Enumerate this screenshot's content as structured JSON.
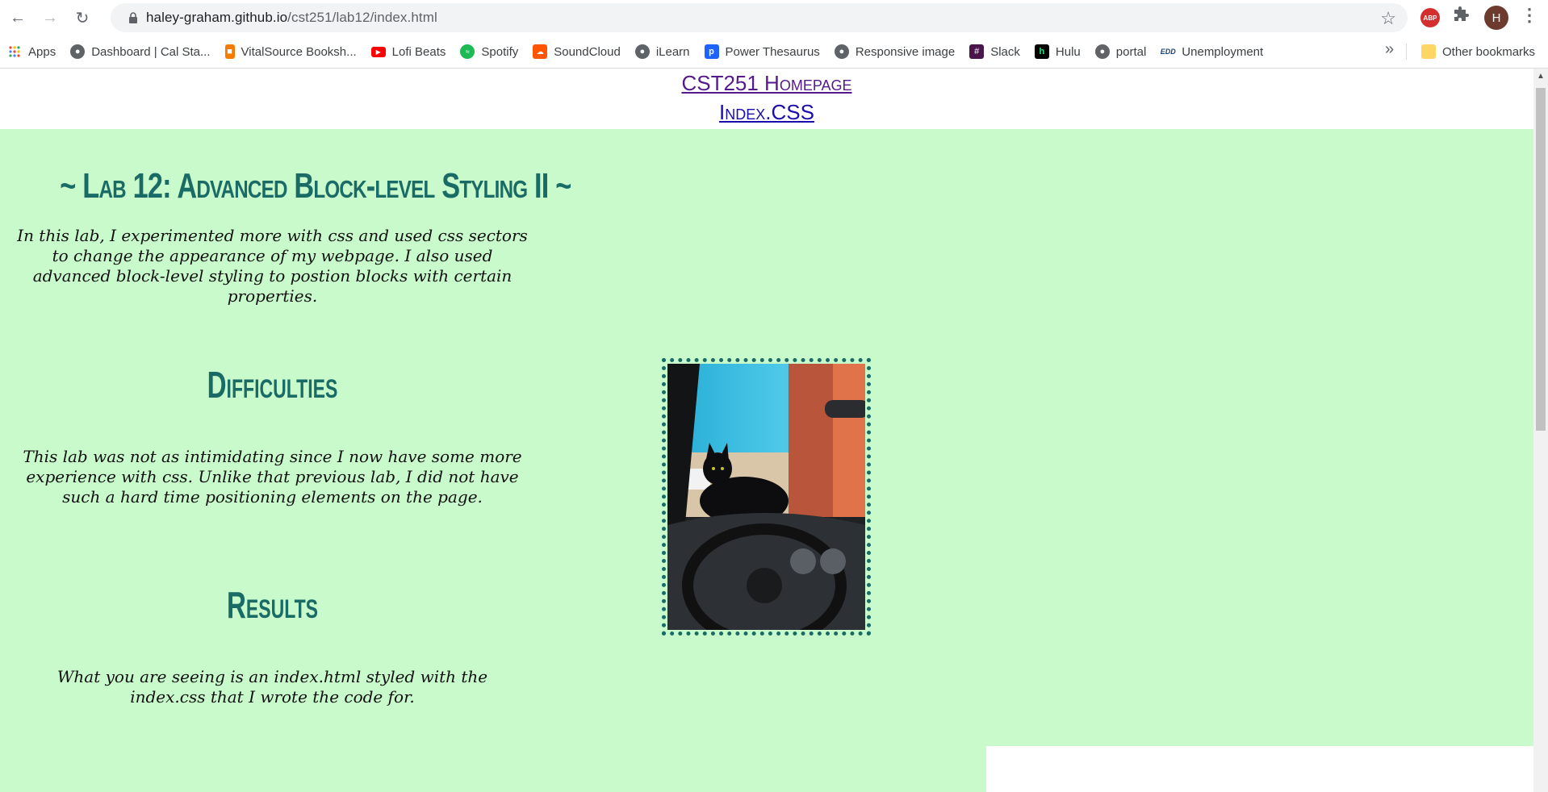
{
  "browser": {
    "url_host": "haley-graham.github.io",
    "url_path": "/cst251/lab12/index.html",
    "profile_initial": "H",
    "abp_label": "ABP"
  },
  "bookmarks": [
    {
      "label": "Apps",
      "icon": "apps-grid-icon",
      "color": "#4285f4"
    },
    {
      "label": "Dashboard | Cal Sta...",
      "icon": "globe-icon",
      "color": "#5f6368"
    },
    {
      "label": "VitalSource Booksh...",
      "icon": "vitalsource-icon",
      "color": "#f57c00"
    },
    {
      "label": "Lofi Beats",
      "icon": "youtube-icon",
      "color": "#ff0000"
    },
    {
      "label": "Spotify",
      "icon": "spotify-icon",
      "color": "#1db954"
    },
    {
      "label": "SoundCloud",
      "icon": "soundcloud-icon",
      "color": "#ff5500"
    },
    {
      "label": "iLearn",
      "icon": "globe-icon",
      "color": "#5f6368"
    },
    {
      "label": "Power Thesaurus",
      "icon": "power-thesaurus-icon",
      "color": "#1e63ff"
    },
    {
      "label": "Responsive image",
      "icon": "globe-icon",
      "color": "#5f6368"
    },
    {
      "label": "Slack",
      "icon": "slack-icon",
      "color": "#4a154b"
    },
    {
      "label": "Hulu",
      "icon": "hulu-icon",
      "color": "#000000"
    },
    {
      "label": "portal",
      "icon": "globe-icon",
      "color": "#5f6368"
    },
    {
      "label": "Unemployment",
      "icon": "edd-icon",
      "color": "#1a4480"
    }
  ],
  "other_bookmarks": "Other bookmarks",
  "page": {
    "nav_home": "CST251 Homepage",
    "nav_css": "Index.CSS",
    "title": "~ Lab 12: Advanced Block-level Styling II ~",
    "intro": "In this lab, I experimented more with css and used css sectors to change the appearance of my webpage. I also used advanced block-level styling to postion blocks with certain properties.",
    "difficulties_heading": "Difficulties",
    "difficulties_text": "This lab was not as intimidating since I now have some more experience with css. Unlike that previous lab, I did not have such a hard time positioning elements on the page.",
    "results_heading": "Results",
    "results_text": "What you are seeing is an index.html styled with the index.css that I wrote the code for.",
    "accent_color": "#1a6b66",
    "background_color": "#c9facb"
  }
}
